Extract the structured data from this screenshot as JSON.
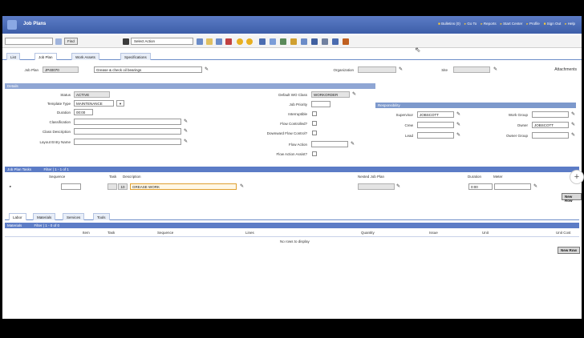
{
  "window": {
    "title": "Job Plans",
    "header_links": [
      "Bulletins (0)",
      "Go To",
      "Reports",
      "Start Center",
      "Profile",
      "Sign Out",
      "Help"
    ]
  },
  "toolbar": {
    "find_label": "Find",
    "select_action": "Select Action"
  },
  "tabs": [
    "List",
    "Job Plan",
    "Work Assets",
    "Specifications"
  ],
  "header": {
    "job_plan_label": "Job Plan",
    "job_plan_value": "JP40070",
    "description_value": "Grease & check oil bearings",
    "organization_label": "Organization",
    "site_label": "Site",
    "attachments_label": "Attachments"
  },
  "details": {
    "section_title": "Details",
    "status_label": "Status",
    "status_value": "ACTIVE",
    "template_type_label": "Template Type",
    "template_type_value": "MAINTENANCE",
    "duration_label": "Duration",
    "duration_value": "00:00",
    "classification_label": "Classification",
    "class_description_label": "Class Description",
    "layout_entry_label": "Layout Entry Name",
    "default_wo_label": "Default WO Class",
    "default_wo_value": "WORKORDER",
    "priority_label": "Job Priority",
    "interruptible_label": "Interruptible",
    "flow_controlled_label": "Flow Controlled?",
    "downward_flow_label": "Downward Flow Control?",
    "flow_action_label": "Flow Action",
    "flow_action_assist_label": "Flow Action Assist?"
  },
  "responsibility": {
    "title": "Responsibility",
    "supervisor_label": "Supervisor",
    "supervisor_value": "JOBSCOTT",
    "crew_label": "Crew",
    "lead_label": "Lead",
    "work_group_label": "Work Group",
    "owner_label": "Owner",
    "owner_value": "JOBSCOTT",
    "owner_group_label": "Owner Group"
  },
  "tasks": {
    "section_title": "Job Plan Tasks",
    "filter_text": "Filter  |  1 - 1 of 1",
    "col_sequence": "Sequence",
    "col_task": "Task",
    "col_description": "Description",
    "col_nested": "Nested Job Plan",
    "col_duration": "Duration",
    "col_meter": "Meter",
    "row_task": "10",
    "row_description": "GREASE WORK",
    "row_duration": "0:00",
    "new_row": "New Row"
  },
  "resource_tabs": [
    "Labor",
    "Materials",
    "Services",
    "Tools"
  ],
  "materials": {
    "section_title": "Materials",
    "filter_text": "Filter  |  1 - 0 of 0",
    "cols": [
      "Item",
      "Task",
      "Sequence",
      "Lines",
      "Quantity",
      "Issue",
      "Unit",
      "Unit Cost"
    ],
    "empty_text": "No rows to display",
    "new_row": "New Row"
  }
}
